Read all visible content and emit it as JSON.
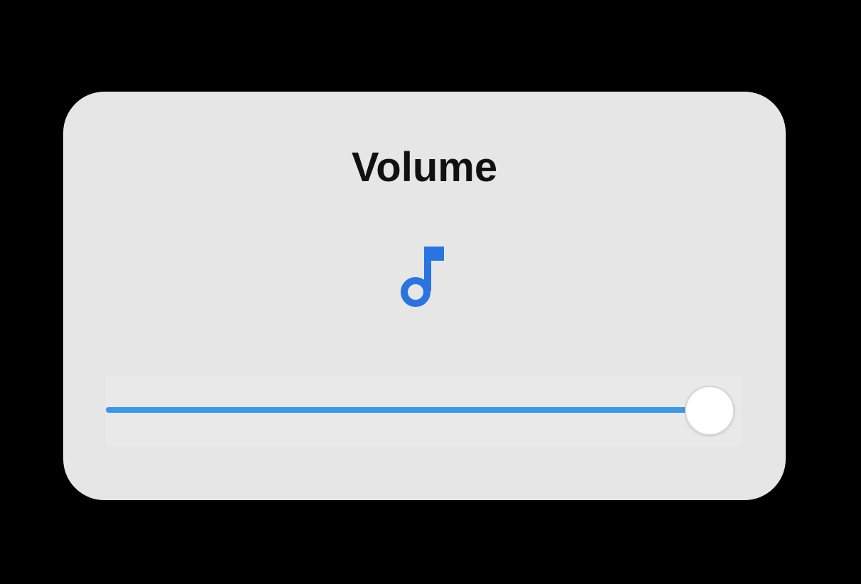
{
  "dialog": {
    "title": "Volume",
    "icon": "music-note-icon",
    "accent_color": "#3b97e8",
    "icon_color": "#2a74e0"
  },
  "volume_slider": {
    "value": 100,
    "min": 0,
    "max": 100
  }
}
